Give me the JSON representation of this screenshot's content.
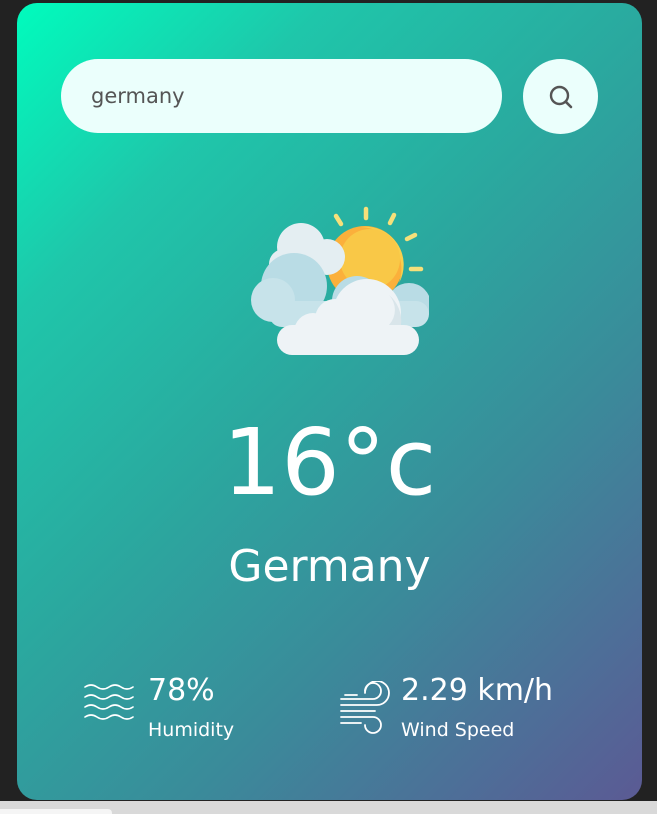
{
  "search": {
    "value": "germany",
    "placeholder": ""
  },
  "weather": {
    "icon": "partly-cloudy-icon",
    "temperature": "16°c",
    "city": "Germany"
  },
  "stats": {
    "humidity": {
      "icon": "humidity-waves-icon",
      "value": "78%",
      "label": "Humidity"
    },
    "wind": {
      "icon": "wind-icon",
      "value": "2.29 km/h",
      "label": "Wind Speed"
    }
  },
  "colors": {
    "gradient_start": "#00fcbd",
    "gradient_end": "#5b5a94",
    "input_background": "#ebfffc",
    "text": "#ffffff",
    "sun": "#fbbf3b",
    "cloud": "#e8f1f5"
  }
}
